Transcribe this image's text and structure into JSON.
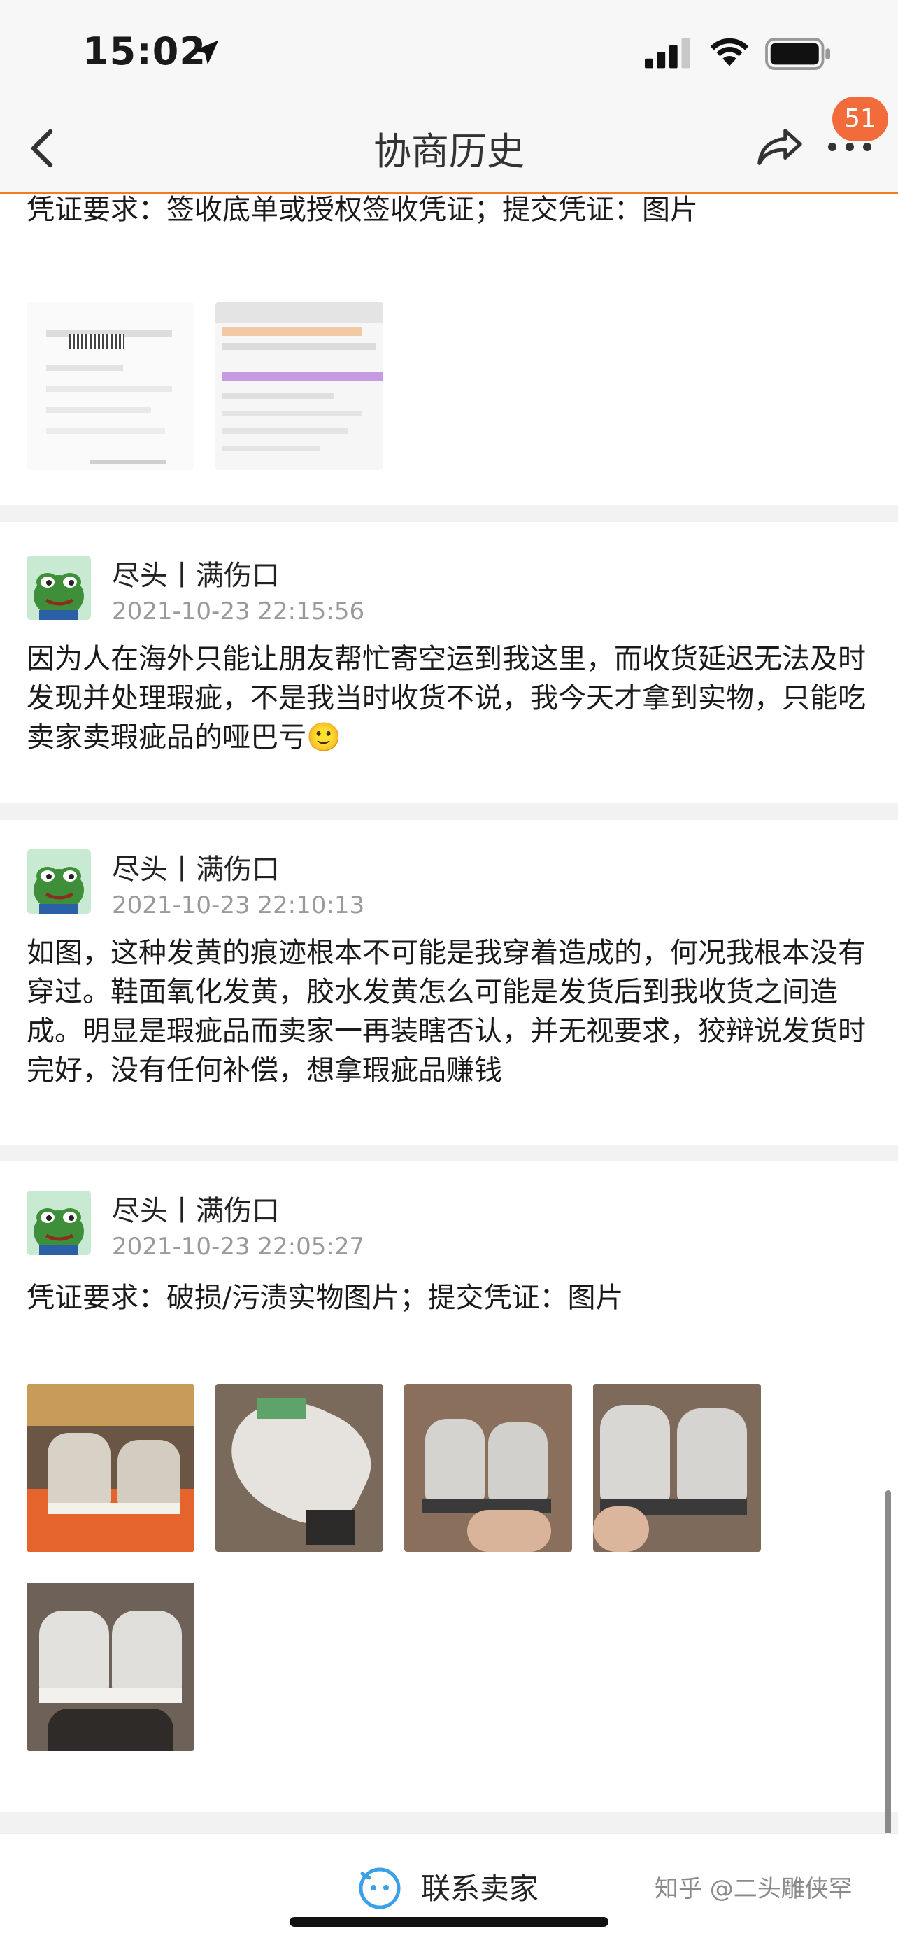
{
  "status_bar": {
    "time": "15:02"
  },
  "nav": {
    "title": "协商历史",
    "badge_count": "51"
  },
  "top_card": {
    "requirement": "凭证要求：签收底单或授权签收凭证；提交凭证：图片"
  },
  "posts": [
    {
      "author": "尽头丨满伤口",
      "time": "2021-10-23 22:15:56",
      "body": "因为人在海外只能让朋友帮忙寄空运到我这里，而收货延迟无法及时发现并处理瑕疵，不是我当时收货不说，我今天才拿到实物，只能吃卖家卖瑕疵品的哑巴亏🙂"
    },
    {
      "author": "尽头丨满伤口",
      "time": "2021-10-23 22:10:13",
      "body": "如图，这种发黄的痕迹根本不可能是我穿着造成的，何况我根本没有穿过。鞋面氧化发黄，胶水发黄怎么可能是发货后到我收货之间造成。明显是瑕疵品而卖家一再装瞎否认，并无视要求，狡辩说发货时完好，没有任何补偿，想拿瑕疵品赚钱"
    },
    {
      "author": "尽头丨满伤口",
      "time": "2021-10-23 22:05:27",
      "requirement": "凭证要求：破损/污渍实物图片；提交凭证：图片"
    }
  ],
  "bottom": {
    "contact_label": "联系卖家",
    "watermark": "知乎 @二头雕侠罕"
  },
  "colors": {
    "accent": "#f47b20",
    "badge": "#f26b3a",
    "time_text": "#9a9a9a"
  }
}
